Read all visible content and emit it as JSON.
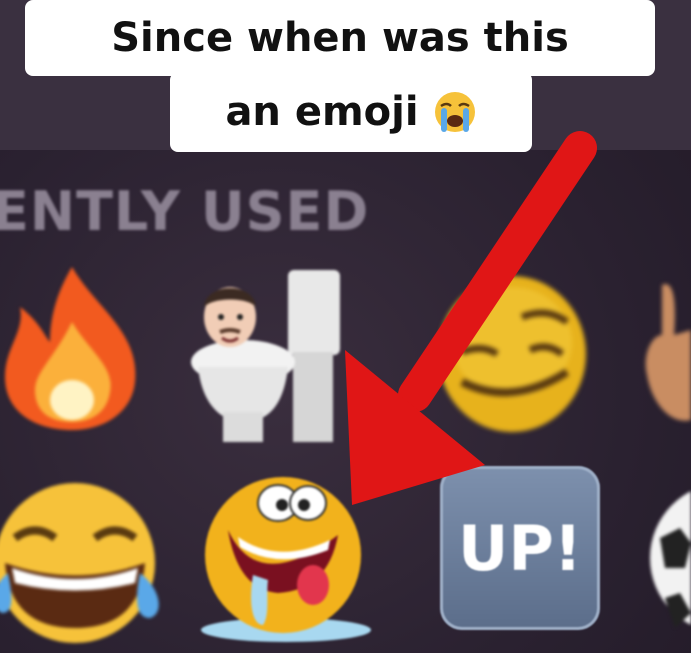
{
  "caption": {
    "line1": "Since when was this",
    "line2": "an emoji",
    "line2_emoji": "loudly-crying-face"
  },
  "keyboard": {
    "section_label": "ENTLY USED",
    "emojis": [
      {
        "name": "fire"
      },
      {
        "name": "skibidi-toilet"
      },
      {
        "name": "smirking-face"
      },
      {
        "name": "hand-partial"
      },
      {
        "name": "face-with-tears-of-joy"
      },
      {
        "name": "drooling-crazy-face"
      },
      {
        "name": "up-button",
        "label": "UP!"
      },
      {
        "name": "soccer-ball-partial"
      }
    ]
  },
  "colors": {
    "arrow": "#e01616",
    "background": "#2d2330",
    "caption_bg": "#ffffff"
  }
}
